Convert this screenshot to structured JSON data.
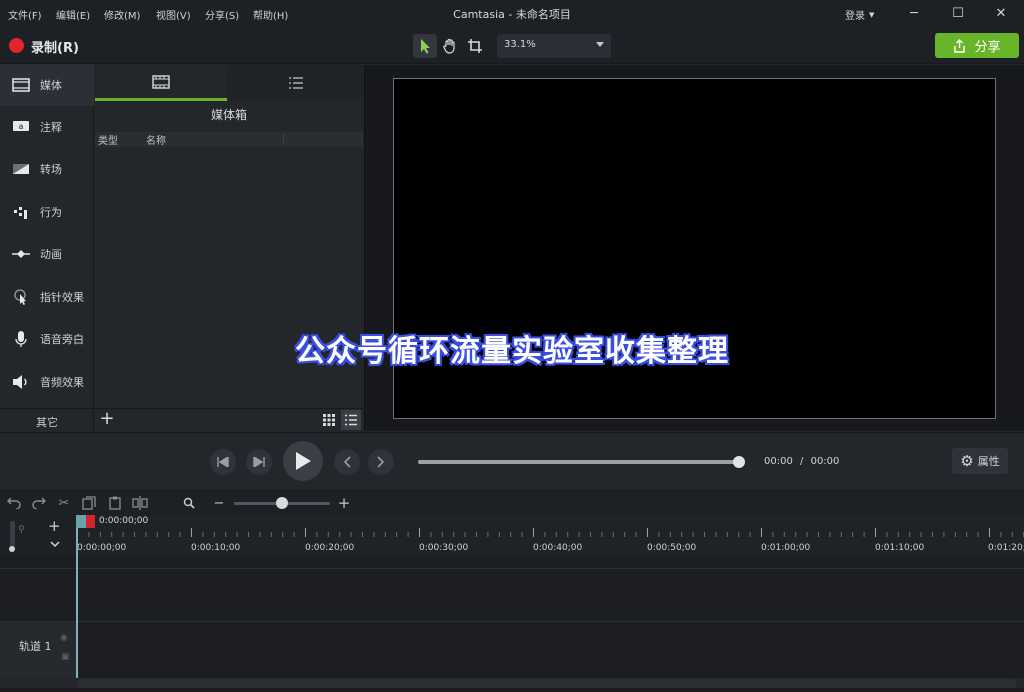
{
  "menu": [
    "文件(F)",
    "编辑(E)",
    "修改(M)",
    "视图(V)",
    "分享(S)",
    "帮助(H)"
  ],
  "app_title": "Camtasia - 未命名项目",
  "login_label": "登录",
  "window_controls": {
    "minimize": "─",
    "maximize": "☐",
    "close": "✕"
  },
  "toolbar": {
    "record_label": "录制(R)",
    "zoom": "33.1%",
    "share_label": "分享"
  },
  "sidebar": {
    "items": [
      {
        "label": "媒体",
        "icon": "film-icon"
      },
      {
        "label": "注释",
        "icon": "annotation-icon"
      },
      {
        "label": "转场",
        "icon": "transition-icon"
      },
      {
        "label": "行为",
        "icon": "behavior-icon"
      },
      {
        "label": "动画",
        "icon": "animation-icon"
      },
      {
        "label": "指针效果",
        "icon": "cursor-effect-icon"
      },
      {
        "label": "语音旁白",
        "icon": "microphone-icon"
      },
      {
        "label": "音频效果",
        "icon": "speaker-icon"
      }
    ],
    "other_label": "其它"
  },
  "bin": {
    "title": "媒体箱",
    "columns": [
      "类型",
      "名称"
    ]
  },
  "overlay_text": "公众号循环流量实验室收集整理",
  "playback": {
    "current_time": "00:00",
    "separator": "/",
    "total_time": "00:00",
    "props_label": "属性",
    "progress": 1.0
  },
  "timeline": {
    "playhead_time": "0:00:00;00",
    "ticks": [
      "0:00:00;00",
      "0:00:10;00",
      "0:00:20;00",
      "0:00:30;00",
      "0:00:40;00",
      "0:00:50;00",
      "0:01:00;00",
      "0:01:10;00",
      "0:01:20;0"
    ],
    "track_label": "轨道 1",
    "zoom_level": 0.45
  },
  "colors": {
    "accent": "#69b52a",
    "record": "#e2242d",
    "overlay_outline": "#3b4fe0"
  }
}
